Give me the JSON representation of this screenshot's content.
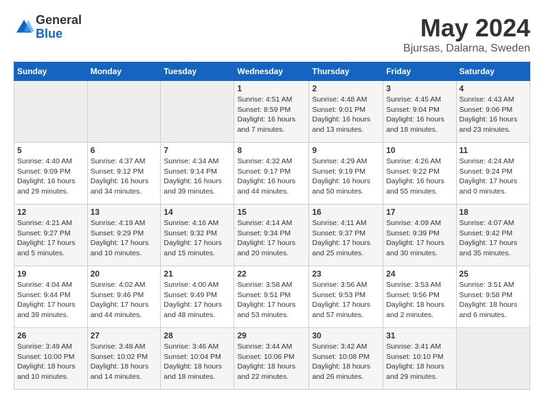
{
  "logo": {
    "general": "General",
    "blue": "Blue"
  },
  "title": {
    "month_year": "May 2024",
    "location": "Bjursas, Dalarna, Sweden"
  },
  "days_of_week": [
    "Sunday",
    "Monday",
    "Tuesday",
    "Wednesday",
    "Thursday",
    "Friday",
    "Saturday"
  ],
  "weeks": [
    [
      {
        "day": "",
        "info": ""
      },
      {
        "day": "",
        "info": ""
      },
      {
        "day": "",
        "info": ""
      },
      {
        "day": "1",
        "info": "Sunrise: 4:51 AM\nSunset: 8:59 PM\nDaylight: 16 hours\nand 7 minutes."
      },
      {
        "day": "2",
        "info": "Sunrise: 4:48 AM\nSunset: 9:01 PM\nDaylight: 16 hours\nand 13 minutes."
      },
      {
        "day": "3",
        "info": "Sunrise: 4:45 AM\nSunset: 9:04 PM\nDaylight: 16 hours\nand 18 minutes."
      },
      {
        "day": "4",
        "info": "Sunrise: 4:43 AM\nSunset: 9:06 PM\nDaylight: 16 hours\nand 23 minutes."
      }
    ],
    [
      {
        "day": "5",
        "info": "Sunrise: 4:40 AM\nSunset: 9:09 PM\nDaylight: 16 hours\nand 29 minutes."
      },
      {
        "day": "6",
        "info": "Sunrise: 4:37 AM\nSunset: 9:12 PM\nDaylight: 16 hours\nand 34 minutes."
      },
      {
        "day": "7",
        "info": "Sunrise: 4:34 AM\nSunset: 9:14 PM\nDaylight: 16 hours\nand 39 minutes."
      },
      {
        "day": "8",
        "info": "Sunrise: 4:32 AM\nSunset: 9:17 PM\nDaylight: 16 hours\nand 44 minutes."
      },
      {
        "day": "9",
        "info": "Sunrise: 4:29 AM\nSunset: 9:19 PM\nDaylight: 16 hours\nand 50 minutes."
      },
      {
        "day": "10",
        "info": "Sunrise: 4:26 AM\nSunset: 9:22 PM\nDaylight: 16 hours\nand 55 minutes."
      },
      {
        "day": "11",
        "info": "Sunrise: 4:24 AM\nSunset: 9:24 PM\nDaylight: 17 hours\nand 0 minutes."
      }
    ],
    [
      {
        "day": "12",
        "info": "Sunrise: 4:21 AM\nSunset: 9:27 PM\nDaylight: 17 hours\nand 5 minutes."
      },
      {
        "day": "13",
        "info": "Sunrise: 4:19 AM\nSunset: 9:29 PM\nDaylight: 17 hours\nand 10 minutes."
      },
      {
        "day": "14",
        "info": "Sunrise: 4:16 AM\nSunset: 9:32 PM\nDaylight: 17 hours\nand 15 minutes."
      },
      {
        "day": "15",
        "info": "Sunrise: 4:14 AM\nSunset: 9:34 PM\nDaylight: 17 hours\nand 20 minutes."
      },
      {
        "day": "16",
        "info": "Sunrise: 4:11 AM\nSunset: 9:37 PM\nDaylight: 17 hours\nand 25 minutes."
      },
      {
        "day": "17",
        "info": "Sunrise: 4:09 AM\nSunset: 9:39 PM\nDaylight: 17 hours\nand 30 minutes."
      },
      {
        "day": "18",
        "info": "Sunrise: 4:07 AM\nSunset: 9:42 PM\nDaylight: 17 hours\nand 35 minutes."
      }
    ],
    [
      {
        "day": "19",
        "info": "Sunrise: 4:04 AM\nSunset: 9:44 PM\nDaylight: 17 hours\nand 39 minutes."
      },
      {
        "day": "20",
        "info": "Sunrise: 4:02 AM\nSunset: 9:46 PM\nDaylight: 17 hours\nand 44 minutes."
      },
      {
        "day": "21",
        "info": "Sunrise: 4:00 AM\nSunset: 9:49 PM\nDaylight: 17 hours\nand 48 minutes."
      },
      {
        "day": "22",
        "info": "Sunrise: 3:58 AM\nSunset: 9:51 PM\nDaylight: 17 hours\nand 53 minutes."
      },
      {
        "day": "23",
        "info": "Sunrise: 3:56 AM\nSunset: 9:53 PM\nDaylight: 17 hours\nand 57 minutes."
      },
      {
        "day": "24",
        "info": "Sunrise: 3:53 AM\nSunset: 9:56 PM\nDaylight: 18 hours\nand 2 minutes."
      },
      {
        "day": "25",
        "info": "Sunrise: 3:51 AM\nSunset: 9:58 PM\nDaylight: 18 hours\nand 6 minutes."
      }
    ],
    [
      {
        "day": "26",
        "info": "Sunrise: 3:49 AM\nSunset: 10:00 PM\nDaylight: 18 hours\nand 10 minutes."
      },
      {
        "day": "27",
        "info": "Sunrise: 3:48 AM\nSunset: 10:02 PM\nDaylight: 18 hours\nand 14 minutes."
      },
      {
        "day": "28",
        "info": "Sunrise: 3:46 AM\nSunset: 10:04 PM\nDaylight: 18 hours\nand 18 minutes."
      },
      {
        "day": "29",
        "info": "Sunrise: 3:44 AM\nSunset: 10:06 PM\nDaylight: 18 hours\nand 22 minutes."
      },
      {
        "day": "30",
        "info": "Sunrise: 3:42 AM\nSunset: 10:08 PM\nDaylight: 18 hours\nand 26 minutes."
      },
      {
        "day": "31",
        "info": "Sunrise: 3:41 AM\nSunset: 10:10 PM\nDaylight: 18 hours\nand 29 minutes."
      },
      {
        "day": "",
        "info": ""
      }
    ]
  ]
}
